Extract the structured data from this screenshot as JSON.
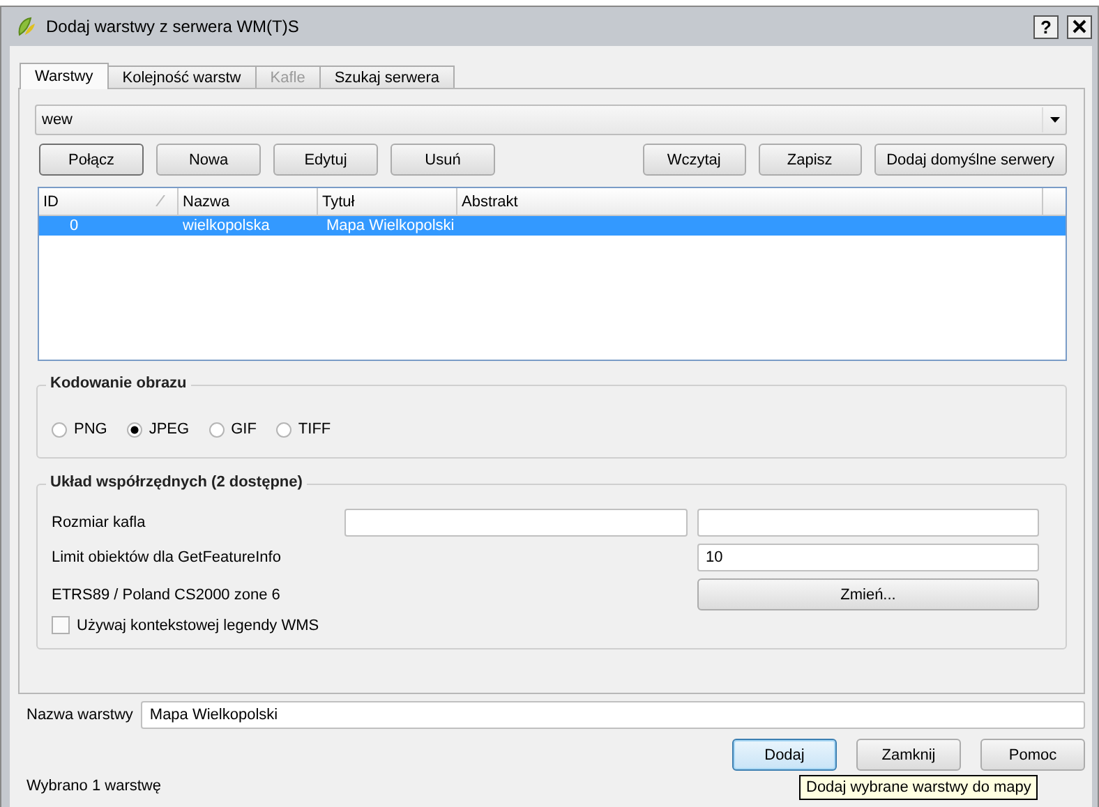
{
  "window": {
    "title": "Dodaj warstwy z serwera WM(T)S",
    "help_button": "?"
  },
  "tabs": [
    {
      "label": "Warstwy",
      "selected": true,
      "disabled": false
    },
    {
      "label": "Kolejność warstw",
      "selected": false,
      "disabled": false
    },
    {
      "label": "Kafle",
      "selected": false,
      "disabled": true
    },
    {
      "label": "Szukaj serwera",
      "selected": false,
      "disabled": false
    }
  ],
  "server_combo": {
    "value": "wew"
  },
  "server_buttons": [
    "Połącz",
    "Nowa",
    "Edytuj",
    "Usuń"
  ],
  "file_buttons": [
    "Wczytaj",
    "Zapisz",
    "Dodaj domyślne serwery"
  ],
  "table": {
    "columns": [
      "ID",
      "Nazwa",
      "Tytuł",
      "Abstrakt"
    ],
    "rows": [
      {
        "cells": [
          "0",
          "wielkopolska",
          "Mapa Wielkopolski"
        ],
        "selected": true
      }
    ]
  },
  "image_encoding": {
    "title": "Kodowanie obrazu",
    "options": [
      {
        "label": "PNG",
        "selected": false
      },
      {
        "label": "JPEG",
        "selected": true
      },
      {
        "label": "GIF",
        "selected": false
      },
      {
        "label": "TIFF",
        "selected": false
      }
    ]
  },
  "crs": {
    "title": "Układ współrzędnych (2 dostępne)",
    "tile_size_label": "Rozmiar kafla",
    "feature_limit_label": "Limit obiektów dla GetFeatureInfo",
    "feature_limit_value": "10",
    "crs_name": "ETRS89 / Poland CS2000 zone 6",
    "change_button": "Zmień...",
    "contextual_legend": {
      "label": "Używaj kontekstowej legendy WMS",
      "checked": false
    }
  },
  "layer_name": {
    "label": "Nazwa warstwy",
    "value": "Mapa Wielkopolski"
  },
  "dialog_buttons": [
    {
      "label": "Dodaj",
      "focused": true
    },
    {
      "label": "Zamknij",
      "focused": false
    },
    {
      "label": "Pomoc",
      "focused": false
    }
  ],
  "status": "Wybrano 1 warstwę",
  "tooltip": "Dodaj wybrane warstwy do mapy"
}
